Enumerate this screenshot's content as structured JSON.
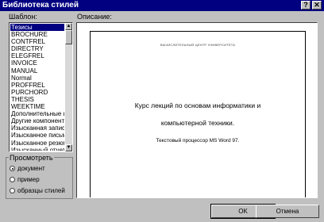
{
  "window": {
    "title": "Библиотека стилей",
    "help_glyph": "?",
    "close_glyph": "✕"
  },
  "templates": {
    "label": "Шаблон:",
    "items": [
      {
        "label": "Тезисы"
      },
      {
        "label": "BROCHURE"
      },
      {
        "label": "CONTFREL"
      },
      {
        "label": "DIRECTRY"
      },
      {
        "label": "ELEGFREL"
      },
      {
        "label": "INVOICE"
      },
      {
        "label": "MANUAL"
      },
      {
        "label": "Normal"
      },
      {
        "label": "PROFFREL"
      },
      {
        "label": "PURCHORD"
      },
      {
        "label": "THESIS"
      },
      {
        "label": "WEEKTIME"
      },
      {
        "label": "Дополнительные ш"
      },
      {
        "label": "Другие компоненты"
      },
      {
        "label": "Изысканная записк"
      },
      {
        "label": "Изысканное письмо"
      },
      {
        "label": "Изысканное резюм"
      },
      {
        "label": "Изысканный отчет"
      }
    ],
    "selected_index": 0,
    "scroll_up_glyph": "▲",
    "scroll_down_glyph": "▼"
  },
  "view": {
    "label": "Просмотреть",
    "options": [
      {
        "label": "документ",
        "checked": true
      },
      {
        "label": "пример",
        "checked": false
      },
      {
        "label": "образцы стилей",
        "checked": false
      }
    ]
  },
  "preview": {
    "label": "Описание:",
    "page_header": "ВЫЧИСЛИТЕЛЬНЫЙ ЦЕНТР УНИВЕРСИТЕТА",
    "title_line1": "Курс лекций по основам информатики и",
    "title_line2": "компьютерной техники.",
    "subtitle": "Текстовый процессор MS Word 97."
  },
  "buttons": {
    "ok": "OK",
    "cancel": "Отмена"
  }
}
